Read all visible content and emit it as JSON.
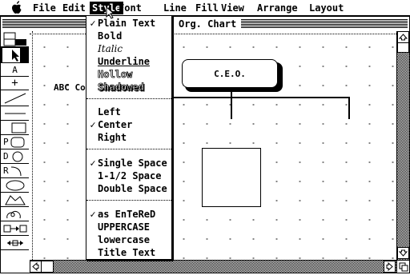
{
  "menubar": {
    "items": [
      "File",
      "Edit",
      "Style",
      "Font",
      "Line",
      "Fill",
      "View",
      "Arrange",
      "Layout"
    ],
    "active": "Style"
  },
  "window": {
    "title": "Org. Chart"
  },
  "palette": {
    "tools": [
      "",
      "",
      "A",
      "+",
      "",
      "",
      "P",
      "D",
      "R",
      "",
      "",
      "",
      "",
      ""
    ]
  },
  "canvas": {
    "text_label": "ABC Co",
    "ceo_box_label": "C.E.O."
  },
  "style_menu": {
    "groups": [
      [
        {
          "label": "Plain Text",
          "checked": true,
          "style": "plain"
        },
        {
          "label": "Bold",
          "checked": false,
          "style": "bold"
        },
        {
          "label": "Italic",
          "checked": false,
          "style": "italic"
        },
        {
          "label": "Underline",
          "checked": false,
          "style": "underline"
        },
        {
          "label": "Hollow",
          "checked": false,
          "style": "hollow"
        },
        {
          "label": "Shadowed",
          "checked": false,
          "style": "shadowed"
        }
      ],
      [
        {
          "label": "Left",
          "checked": false,
          "style": "plain"
        },
        {
          "label": "Center",
          "checked": true,
          "style": "plain"
        },
        {
          "label": "Right",
          "checked": false,
          "style": "plain"
        }
      ],
      [
        {
          "label": "Single Space",
          "checked": true,
          "style": "plain"
        },
        {
          "label": "1-1/2 Space",
          "checked": false,
          "style": "plain"
        },
        {
          "label": "Double Space",
          "checked": false,
          "style": "plain"
        }
      ],
      [
        {
          "label": "as EnTeReD",
          "checked": true,
          "style": "plain"
        },
        {
          "label": "UPPERCASE",
          "checked": false,
          "style": "plain"
        },
        {
          "label": "lowercase",
          "checked": false,
          "style": "plain"
        },
        {
          "label": "Title Text",
          "checked": false,
          "style": "plain"
        }
      ]
    ],
    "check_glyph": "✓"
  }
}
